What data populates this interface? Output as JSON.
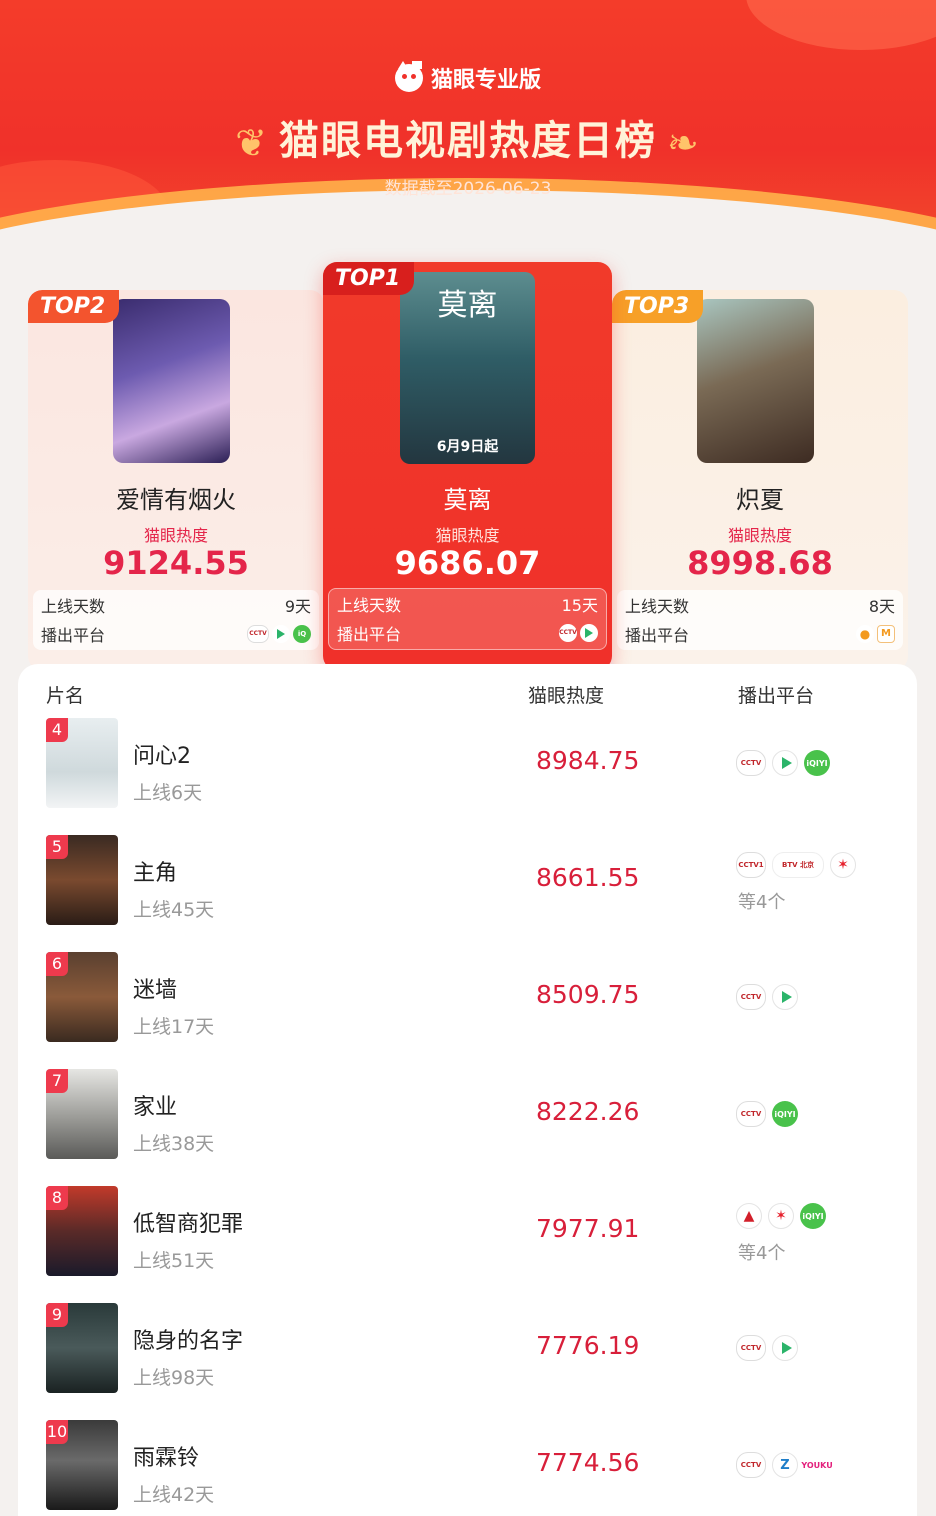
{
  "header": {
    "brand": "猫眼专业版",
    "title": "猫眼电视剧热度日榜",
    "date": "数据截至2026-06-23"
  },
  "top3": [
    {
      "badge": "TOP2",
      "name": "爱情有烟火",
      "label": "猫眼热度",
      "score": "9124.55",
      "days_label": "上线天数",
      "days": "9天",
      "platform_label": "播出平台",
      "platforms": [
        "cctv-icon",
        "tencent-video-icon",
        "iqiyi-icon"
      ]
    },
    {
      "badge": "TOP1",
      "name": "莫离",
      "label": "猫眼热度",
      "score": "9686.07",
      "days_label": "上线天数",
      "days": "15天",
      "platform_label": "播出平台",
      "poster_title": "莫离",
      "poster_caption": "6月9日起",
      "platforms": [
        "cctv-icon",
        "tencent-video-icon"
      ]
    },
    {
      "badge": "TOP3",
      "name": "炽夏",
      "label": "猫眼热度",
      "score": "8998.68",
      "days_label": "上线天数",
      "days": "8天",
      "platform_label": "播出平台",
      "platforms": [
        "mango-icon",
        "mgtv-icon"
      ]
    }
  ],
  "table": {
    "col_name": "片名",
    "col_score": "猫眼热度",
    "col_platform": "播出平台",
    "rows": [
      {
        "rank": "4",
        "name": "问心2",
        "days": "上线6天",
        "score": "8984.75",
        "platforms": [
          "cctv-icon",
          "tencent-video-icon",
          "iqiyi-icon"
        ],
        "more": ""
      },
      {
        "rank": "5",
        "name": "主角",
        "days": "上线45天",
        "score": "8661.55",
        "platforms": [
          "cctv1-icon",
          "btv-icon",
          "dragon-tv-icon"
        ],
        "more": "等4个"
      },
      {
        "rank": "6",
        "name": "迷墙",
        "days": "上线17天",
        "score": "8509.75",
        "platforms": [
          "cctv-icon",
          "tencent-video-icon"
        ],
        "more": ""
      },
      {
        "rank": "7",
        "name": "家业",
        "days": "上线38天",
        "score": "8222.26",
        "platforms": [
          "cctv-icon",
          "iqiyi-icon"
        ],
        "more": ""
      },
      {
        "rank": "8",
        "name": "低智商犯罪",
        "days": "上线51天",
        "score": "7977.91",
        "platforms": [
          "hunan-tv-icon",
          "dragon-tv-icon",
          "iqiyi-icon"
        ],
        "more": "等4个"
      },
      {
        "rank": "9",
        "name": "隐身的名字",
        "days": "上线98天",
        "score": "7776.19",
        "platforms": [
          "cctv-icon",
          "tencent-video-icon"
        ],
        "more": ""
      },
      {
        "rank": "10",
        "name": "雨霖铃",
        "days": "上线42天",
        "score": "7774.56",
        "platforms": [
          "cctv-icon",
          "zhejiang-tv-icon",
          "youku-icon"
        ],
        "more": ""
      }
    ]
  }
}
